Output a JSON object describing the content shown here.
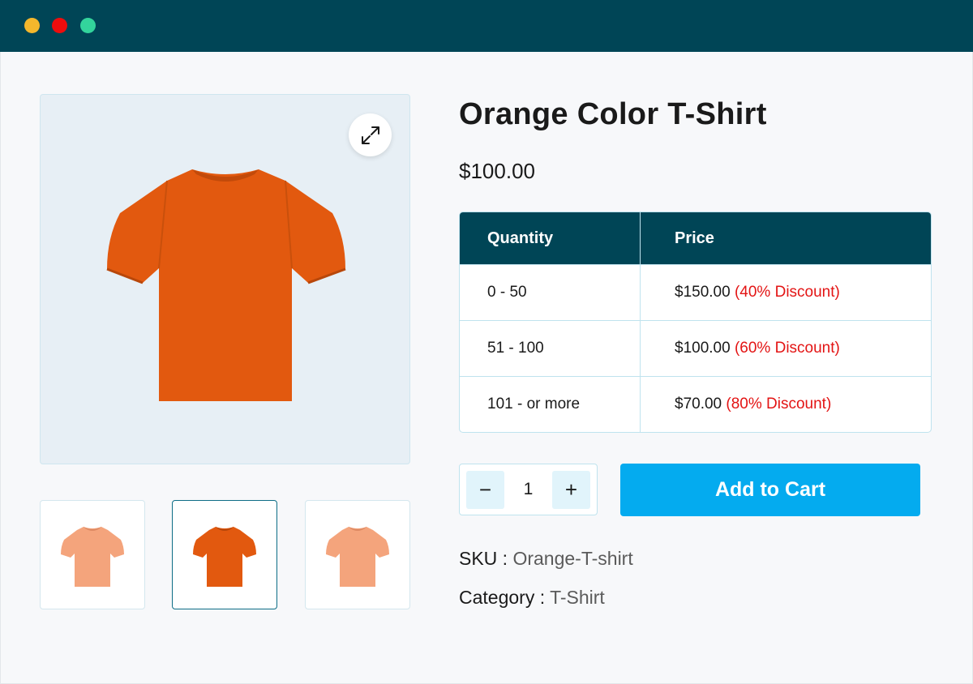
{
  "window": {
    "controls": [
      "close",
      "minimize",
      "maximize"
    ]
  },
  "product": {
    "title": "Orange Color T-Shirt",
    "price": "$100.00",
    "main_image_icon": "orange-tshirt",
    "colors": {
      "orange": "#e2590f",
      "peach": "#f4a47c"
    }
  },
  "pricing_table": {
    "headers": [
      "Quantity",
      "Price"
    ],
    "rows": [
      {
        "quantity": "0 - 50",
        "price": "$150.00",
        "discount": "(40% Discount)"
      },
      {
        "quantity": "51 - 100",
        "price": "$100.00",
        "discount": "(60% Discount)"
      },
      {
        "quantity": "101 - or more",
        "price": "$70.00",
        "discount": "(80% Discount)"
      }
    ]
  },
  "quantity": {
    "minus": "−",
    "value": "1",
    "plus": "+"
  },
  "cart": {
    "label": "Add to Cart"
  },
  "meta": {
    "sku_label": "SKU :",
    "sku_value": "Orange-T-shirt",
    "category_label": "Category :",
    "category_value": "T-Shirt"
  },
  "thumbnails": [
    {
      "icon": "peach-tshirt",
      "selected": false
    },
    {
      "icon": "orange-tshirt",
      "selected": true
    },
    {
      "icon": "peach-tshirt",
      "selected": false
    }
  ],
  "theme": {
    "header": "#004556",
    "accent": "#04abef",
    "discount": "#e31414"
  }
}
